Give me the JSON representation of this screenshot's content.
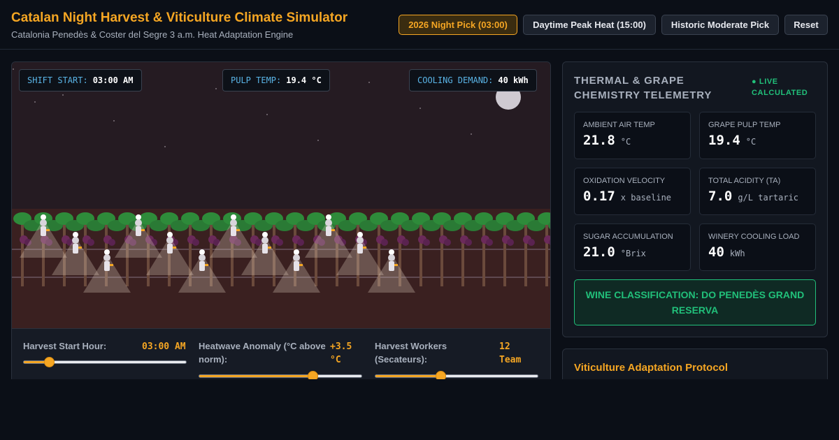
{
  "header": {
    "title": "Catalan Night Harvest & Viticulture Climate Simulator",
    "subtitle": "Catalonia Penedès & Coster del Segre 3 a.m. Heat Adaptation Engine",
    "buttons": [
      {
        "label": "2026 Night Pick (03:00)",
        "active": true
      },
      {
        "label": "Daytime Peak Heat (15:00)",
        "active": false
      },
      {
        "label": "Historic Moderate Pick",
        "active": false
      },
      {
        "label": "Reset",
        "active": false
      }
    ]
  },
  "hud": {
    "shift_label": "SHIFT START:",
    "shift_value": "03:00 AM",
    "pulp_label": "PULP TEMP:",
    "pulp_value": "19.4 °C",
    "cooling_label": "COOLING DEMAND:",
    "cooling_value": "40 kWh"
  },
  "controls": {
    "harvest_hour": {
      "label": "Harvest Start Hour:",
      "value": "03:00 AM",
      "fraction": 0.155
    },
    "heatwave": {
      "label": "Heatwave Anomaly (°C above norm):",
      "value": "+3.5 °C",
      "fraction": 0.7
    },
    "workers": {
      "label": "Harvest Workers (Secateurs):",
      "value": "12 Team",
      "fraction": 0.4
    }
  },
  "telemetry": {
    "title": "THERMAL & GRAPE CHEMISTRY TELEMETRY",
    "live": "● LIVE CALCULATED",
    "metrics": [
      {
        "label": "AMBIENT AIR TEMP",
        "value": "21.8",
        "unit": "°C"
      },
      {
        "label": "GRAPE PULP TEMP",
        "value": "19.4",
        "unit": "°C"
      },
      {
        "label": "OXIDATION VELOCITY",
        "value": "0.17",
        "unit": "x baseline"
      },
      {
        "label": "TOTAL ACIDITY (TA)",
        "value": "7.0",
        "unit": "g/L tartaric"
      },
      {
        "label": "SUGAR ACCUMULATION",
        "value": "21.0",
        "unit": "°Brix"
      },
      {
        "label": "WINERY COOLING LOAD",
        "value": "40",
        "unit": "kWh"
      }
    ],
    "classification": "WINE CLASSIFICATION: DO PENEDÈS GRAND RESERVA"
  },
  "protocol": {
    "title": "Viticulture Adaptation Protocol"
  },
  "colors": {
    "accent": "#f5a623",
    "live": "#21c07a",
    "hud_label": "#5ab4e6",
    "grape": "#6b2a5a",
    "leaf": "#2e8b3a"
  }
}
